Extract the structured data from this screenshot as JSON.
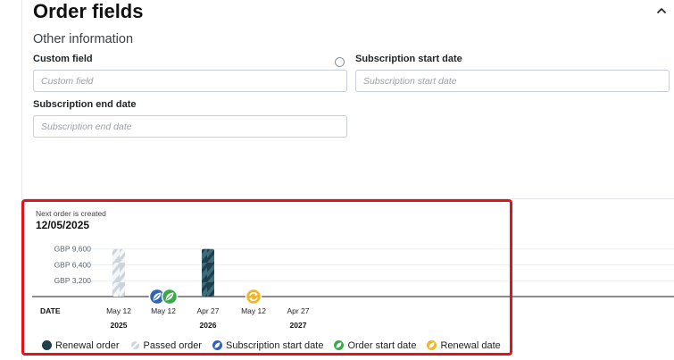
{
  "header": {
    "title": "Order fields",
    "subtitle": "Other information"
  },
  "fields": {
    "custom_field": {
      "label": "Custom field",
      "placeholder": "Custom field",
      "value": ""
    },
    "subscription_start_date": {
      "label": "Subscription start date",
      "placeholder": "Subscription start date",
      "value": ""
    },
    "subscription_end_date": {
      "label": "Subscription end date",
      "placeholder": "Subscription end date",
      "value": ""
    }
  },
  "timeline": {
    "next_order_label": "Next order is created",
    "next_order_date": "12/05/2025",
    "date_header": "DATE"
  },
  "colors": {
    "renewal_order": "#1f3f4c",
    "renewal_order_stripe": "#3d6c7a",
    "passed_order": "#cdd4dc",
    "subscription_start": "#2f63b5",
    "order_start": "#39a94b",
    "renewal_date": "#efb62b",
    "highlight": "#e0141b"
  },
  "chart_data": {
    "type": "bar",
    "y_ticks": [
      "GBP 9,600",
      "GBP 6,400",
      "GBP 3,200"
    ],
    "y_tick_values": [
      9600,
      6400,
      3200
    ],
    "ylim": [
      0,
      10000
    ],
    "x_labels": [
      "May 12",
      "May 12",
      "Apr 27",
      "May 12",
      "Apr 27"
    ],
    "year_labels": [
      {
        "under_index": 0,
        "year": "2025"
      },
      {
        "under_index": 2,
        "year": "2026"
      },
      {
        "under_index": 4,
        "year": "2027"
      }
    ],
    "bars": [
      {
        "x_index": 0,
        "value": 9600,
        "kind": "passed"
      },
      {
        "x_index": 2,
        "value": 9600,
        "kind": "renewal"
      }
    ],
    "events": [
      {
        "x_index": 1,
        "types": [
          "subscription_start",
          "order_start"
        ]
      },
      {
        "x_index": 3,
        "types": [
          "renewal_date"
        ]
      }
    ],
    "legend": [
      {
        "key": "renewal_order",
        "label": "Renewal order"
      },
      {
        "key": "passed_order",
        "label": "Passed order"
      },
      {
        "key": "subscription_start",
        "label": "Subscription start date"
      },
      {
        "key": "order_start",
        "label": "Order start date"
      },
      {
        "key": "renewal_date",
        "label": "Renewal date"
      }
    ]
  }
}
